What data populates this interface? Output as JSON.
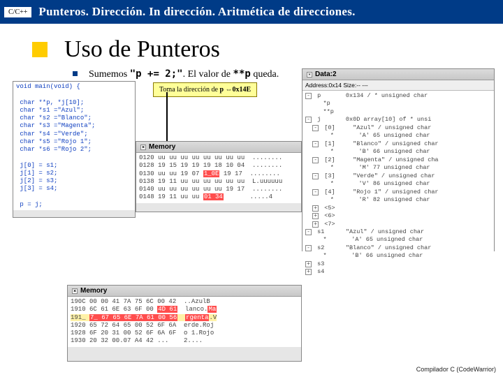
{
  "topbar": {
    "tag": "C/C++",
    "title": "Punteros. Dirección. In dirección. Aritmética de direcciones."
  },
  "heading": "Uso de Punteros",
  "bullet": {
    "pre": "Sumemos ",
    "code1": "\"p += 2;\"",
    "mid": ". El valor de ",
    "code2": "**p",
    "post": " queda."
  },
  "callout": {
    "text1": "Toma la dirección de ",
    "bold": "p",
    "arrow": " ⇔",
    "addr": "0x14E"
  },
  "codepanel": {
    "title": "",
    "body": "void main(void) {\n\n char **p, *j[10];\n char *s1 =\"Azul\";\n char *s2 =\"Blanco\";\n char *s3 =\"Magenta\";\n char *s4 =\"Verde\";\n char *s5 =\"Rojo 1\";\n char *s6 =\"Rojo 2\";\n\n j[0] = s1;\n j[1] = s2;\n j[2] = s3;\n j[3] = s4;\n\n p = j;"
  },
  "mem1": {
    "title": "Memory",
    "rows": [
      "0120 uu uu uu uu uu uu uu uu  ........",
      "0128 19 15 19 19 19 18 10 04  ........",
      "0130 uu uu 19 07 ",
      "1_0E",
      " 19 17  ........",
      "0138 19 11 uu uu uu uu uu uu  L.uuuuuu",
      "0140 uu uu uu uu uu uu 19 17  ........",
      "0148 19 11 uu uu ",
      "01 34",
      "       .....4"
    ]
  },
  "mem2": {
    "title": "Memory",
    "rows": [
      "190C 00 00 41 7A 75 6C 00 42  ..AzulB",
      "1910 6C 61 6E 63 6F 00 ",
      "4D 61",
      "  lanco.",
      "Ma",
      "191_ ",
      "7_ 67 65 6E 7A 61 00 56",
      "  ",
      "rgenta",
      ".V",
      "1920 65 72 64 65 00 52 6F 6A  erde.Roj",
      "1928 6F 20 31 00 52 6F 6A 6F  o 1.Rojo",
      "1930 20 32 00.07 A4 42 ...    2...."
    ]
  },
  "data": {
    "title": "Data:2",
    "sub": "Address:0x14   Size:--   ---",
    "rows": [
      {
        "ind": 0,
        "box": "-",
        "t": "p",
        "v": "0x134 / * unsigned char"
      },
      {
        "ind": 1,
        "box": "",
        "t": "*p",
        "v": ""
      },
      {
        "ind": 1,
        "box": "",
        "t": "**p",
        "v": ""
      },
      {
        "ind": 0,
        "box": "-",
        "t": "j",
        "v": "0x0D array[10] of * unsi"
      },
      {
        "ind": 1,
        "box": "-",
        "t": "[0]",
        "v": "\"Azul\" / unsigned char"
      },
      {
        "ind": 2,
        "box": "",
        "t": "*",
        "v": "'A' 65 unsigned char"
      },
      {
        "ind": 1,
        "box": "-",
        "t": "[1]",
        "v": "\"Blanco\" / unsigned char"
      },
      {
        "ind": 2,
        "box": "",
        "t": "*",
        "v": "'B' 66 unsigned char"
      },
      {
        "ind": 1,
        "box": "-",
        "t": "[2]",
        "v": "\"Magenta\" / unsigned cha"
      },
      {
        "ind": 2,
        "box": "",
        "t": "*",
        "v": "'M' 77 unsigned char"
      },
      {
        "ind": 1,
        "box": "-",
        "t": "[3]",
        "v": "\"Verde\" / unsigned char"
      },
      {
        "ind": 2,
        "box": "",
        "t": "*",
        "v": "'V' 86 unsigned char"
      },
      {
        "ind": 1,
        "box": "-",
        "t": "[4]",
        "v": "\"Rojo 1\" / unsigned char"
      },
      {
        "ind": 2,
        "box": "",
        "t": "*",
        "v": "'R' 82 unsigned char"
      },
      {
        "ind": 1,
        "box": "+",
        "t": "<5>",
        "v": ""
      },
      {
        "ind": 1,
        "box": "+",
        "t": "<6>",
        "v": ""
      },
      {
        "ind": 1,
        "box": "+",
        "t": "<7>",
        "v": ""
      },
      {
        "ind": 0,
        "box": "-",
        "t": "s1",
        "v": "\"Azul\" / unsigned char"
      },
      {
        "ind": 1,
        "box": "",
        "t": "*",
        "v": "'A' 65 unsigned char"
      },
      {
        "ind": 0,
        "box": "-",
        "t": "s2",
        "v": "\"Blanco\" / unsigned char"
      },
      {
        "ind": 1,
        "box": "",
        "t": "*",
        "v": "'B' 66 unsigned char"
      },
      {
        "ind": 0,
        "box": "+",
        "t": "s3",
        "v": ""
      },
      {
        "ind": 0,
        "box": "+",
        "t": "s4",
        "v": ""
      }
    ]
  },
  "footer": "Compilador C (CodeWarrior)"
}
